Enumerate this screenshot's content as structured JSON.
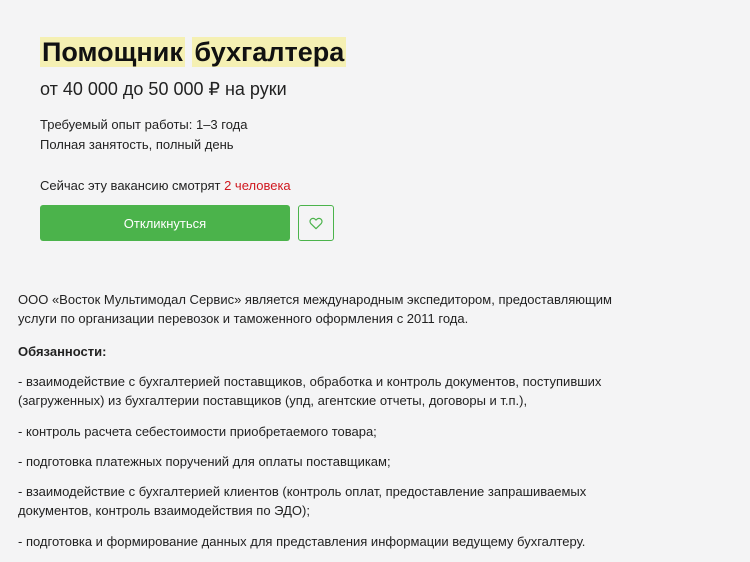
{
  "vacancy": {
    "title_word1": "Помощник",
    "title_word2": "бухгалтера",
    "salary": "от 40 000 до 50 000 ₽ на руки",
    "experience": "Требуемый опыт работы: 1–3 года",
    "employment": "Полная занятость, полный день",
    "viewers_prefix": "Сейчас эту вакансию смотрят ",
    "viewers_count": "2 человека",
    "apply_label": "Откликнуться",
    "favorite_icon": "heart-outline"
  },
  "description": {
    "intro_line1": "ООО «Восток Мультимодал Сервис» является международным экспедитором, предоставляющим",
    "intro_line2": "услуги по организации перевозок и таможенного оформления с 2011 года.",
    "duties_heading": "Обязанности:",
    "duties": [
      {
        "line1": "- взаимодействие с бухгалтерией поставщиков, обработка и контроль документов, поступивших",
        "line2": "(загруженных) из бухгалтерии поставщиков (упд, агентские отчеты, договоры и т.п.),"
      },
      {
        "line1": "- контроль расчета себестоимости приобретаемого товара;",
        "line2": ""
      },
      {
        "line1": "- подготовка платежных поручений для оплаты поставщикам;",
        "line2": ""
      },
      {
        "line1": "- взаимодействие с бухгалтерией клиентов (контроль оплат, предоставление запрашиваемых",
        "line2": "документов, контроль взаимодействия по ЭДО);"
      },
      {
        "line1": "- подготовка и формирование данных для представления информации ведущему бухгалтеру.",
        "line2": ""
      }
    ]
  },
  "colors": {
    "accent_green": "#4bb34b",
    "highlight_yellow": "#f5f0b3",
    "alert_red": "#d0181f"
  }
}
